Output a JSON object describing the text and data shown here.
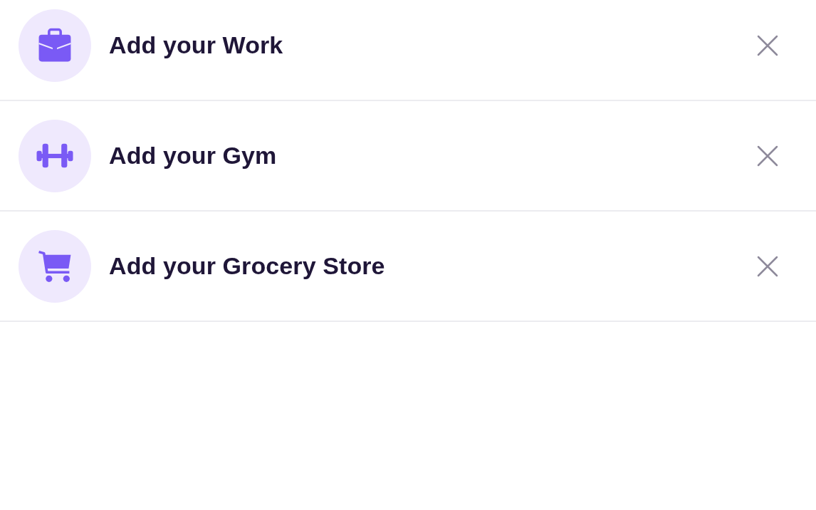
{
  "places": [
    {
      "label": "Add your Work"
    },
    {
      "label": "Add your Gym"
    },
    {
      "label": "Add your Grocery Store"
    }
  ]
}
